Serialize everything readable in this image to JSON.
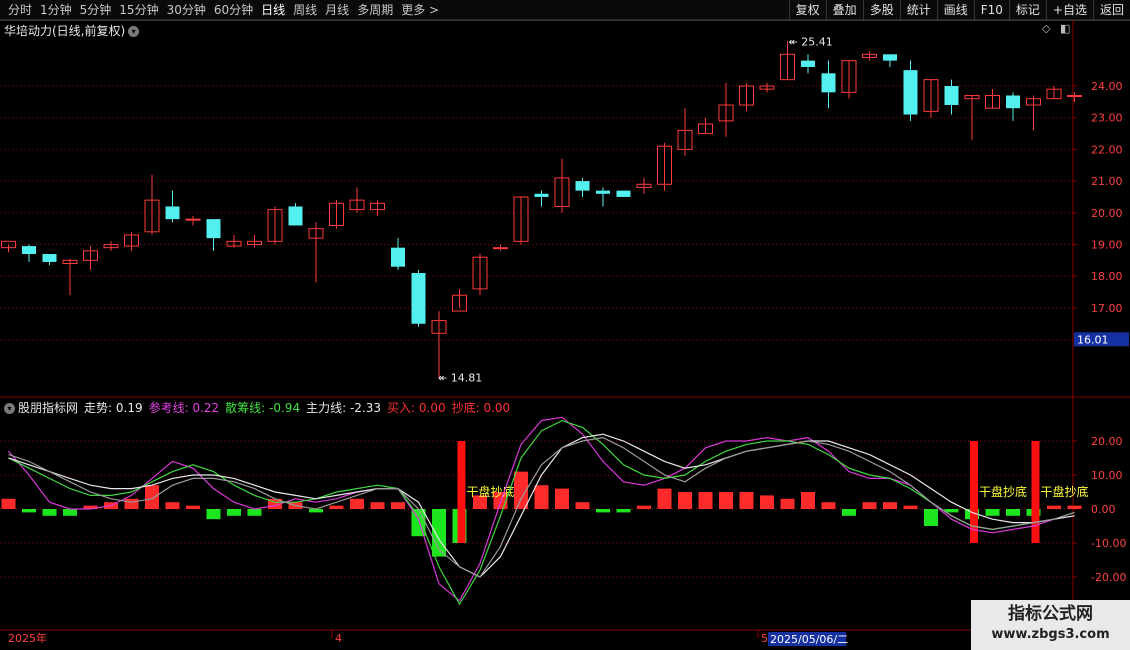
{
  "toolbar": {
    "periods": [
      "分时",
      "1分钟",
      "5分钟",
      "15分钟",
      "30分钟",
      "60分钟",
      "日线",
      "周线",
      "月线",
      "多周期",
      "更多 >"
    ],
    "active_period": "日线",
    "buttons": [
      "复权",
      "叠加",
      "多股",
      "统计",
      "画线",
      "F10",
      "标记",
      "+自选",
      "返回"
    ]
  },
  "stock": {
    "title": "华培动力(日线,前复权)",
    "high_label": "25.41",
    "low_label": "14.81",
    "current_price": "16.01",
    "price_ticks": [
      "24.00",
      "23.00",
      "22.00",
      "21.00",
      "20.00",
      "19.00",
      "18.00",
      "17.00",
      "16.00"
    ]
  },
  "indicator": {
    "name": "股朋指标网",
    "values": [
      {
        "label": "走势: 0.19",
        "color": "#e8e8e8"
      },
      {
        "label": "参考线: 0.22",
        "color": "#e040e0"
      },
      {
        "label": "散筹线: -0.94",
        "color": "#40e040"
      },
      {
        "label": "主力线: -2.33",
        "color": "#e8e8e8"
      },
      {
        "label": "买入: 0.00",
        "color": "#ff3030"
      },
      {
        "label": "抄底: 0.00",
        "color": "#ff3030"
      }
    ],
    "ticks": [
      "20.00",
      "10.00",
      "0.00",
      "-10.00",
      "-20.00"
    ],
    "signal_label": "干盘抄底"
  },
  "timeline": {
    "labels": [
      "2025年",
      "4",
      "5"
    ],
    "cursor_date": "2025/05/06/二"
  },
  "watermark": {
    "title": "指标公式网",
    "url": "www.zbgs3.com"
  },
  "colors": {
    "up": "#ff3b3b",
    "down": "#54f0f0",
    "grid": "#8b0000",
    "axis_text": "#ff4040",
    "accent_blue": "#1530a0"
  },
  "chart_data": {
    "type": "candlestick",
    "candles": [
      [
        18.9,
        19.1,
        18.75,
        19.0
      ],
      [
        18.95,
        18.7,
        18.45,
        19.0
      ],
      [
        18.7,
        18.45,
        18.35,
        18.7
      ],
      [
        18.4,
        18.5,
        17.4,
        18.55
      ],
      [
        18.5,
        18.8,
        18.2,
        18.95
      ],
      [
        18.9,
        19.0,
        18.8,
        19.1
      ],
      [
        18.95,
        19.3,
        18.8,
        19.4
      ],
      [
        19.4,
        20.4,
        19.3,
        21.2
      ],
      [
        20.2,
        19.8,
        19.7,
        20.7
      ],
      [
        19.8,
        19.8,
        19.6,
        19.9
      ],
      [
        19.8,
        19.2,
        18.8,
        19.8
      ],
      [
        18.95,
        19.1,
        18.9,
        19.3
      ],
      [
        19.0,
        19.1,
        18.9,
        19.3
      ],
      [
        19.1,
        20.1,
        19.0,
        20.2
      ],
      [
        20.2,
        19.6,
        19.6,
        20.3
      ],
      [
        19.2,
        19.5,
        17.8,
        19.7
      ],
      [
        19.6,
        20.3,
        19.5,
        20.4
      ],
      [
        20.1,
        20.4,
        20.0,
        20.8
      ],
      [
        20.1,
        20.3,
        19.9,
        20.4
      ],
      [
        18.9,
        18.3,
        18.2,
        19.2
      ],
      [
        18.1,
        16.5,
        16.4,
        18.2
      ],
      [
        16.2,
        16.6,
        14.81,
        16.9
      ],
      [
        16.9,
        17.4,
        17.0,
        17.6
      ],
      [
        17.6,
        18.6,
        17.4,
        18.7
      ],
      [
        18.9,
        18.9,
        18.8,
        19.0
      ],
      [
        19.1,
        20.5,
        19.0,
        20.5
      ],
      [
        20.6,
        20.5,
        20.2,
        20.7
      ],
      [
        20.2,
        21.1,
        20.0,
        21.7
      ],
      [
        21.0,
        20.7,
        20.5,
        21.1
      ],
      [
        20.7,
        20.6,
        20.2,
        20.8
      ],
      [
        20.7,
        20.5,
        20.5,
        20.7
      ],
      [
        20.8,
        20.9,
        20.6,
        21.1
      ],
      [
        20.9,
        22.1,
        20.7,
        22.2
      ],
      [
        22.0,
        22.6,
        21.8,
        23.3
      ],
      [
        22.5,
        22.8,
        22.5,
        23.0
      ],
      [
        22.9,
        23.4,
        22.4,
        24.1
      ],
      [
        23.4,
        24.0,
        23.2,
        24.1
      ],
      [
        23.9,
        24.0,
        23.8,
        24.1
      ],
      [
        24.2,
        25.0,
        24.2,
        25.41
      ],
      [
        24.8,
        24.6,
        24.4,
        25.0
      ],
      [
        24.4,
        23.8,
        23.3,
        24.8
      ],
      [
        23.8,
        24.8,
        23.6,
        24.8
      ],
      [
        24.9,
        25.0,
        24.8,
        25.1
      ],
      [
        25.0,
        24.8,
        24.6,
        25.0
      ],
      [
        24.5,
        23.1,
        22.9,
        24.8
      ],
      [
        23.2,
        24.2,
        23.0,
        24.2
      ],
      [
        24.0,
        23.4,
        23.1,
        24.2
      ],
      [
        23.6,
        23.7,
        22.3,
        23.7
      ],
      [
        23.3,
        23.7,
        23.3,
        23.9
      ],
      [
        23.7,
        23.3,
        22.9,
        23.8
      ],
      [
        23.4,
        23.6,
        22.6,
        23.7
      ],
      [
        23.6,
        23.9,
        23.6,
        24.0
      ],
      [
        23.7,
        23.7,
        23.5,
        23.8
      ]
    ],
    "histogram": [
      3,
      -1,
      -2,
      -2,
      1,
      2,
      3,
      7,
      2,
      1,
      -3,
      -2,
      -2,
      3,
      2,
      -1,
      1,
      3,
      2,
      2,
      -8,
      -14,
      -10,
      4,
      5,
      11,
      7,
      6,
      2,
      -1,
      -1,
      1,
      6,
      5,
      5,
      5,
      5,
      4,
      3,
      5,
      2,
      -2,
      2,
      2,
      1,
      -5,
      -1,
      -3,
      -2,
      -2,
      -2,
      1,
      1
    ],
    "buy_signals": [
      22,
      47,
      50
    ],
    "lines": {
      "zoushi": [
        16,
        14,
        11,
        8,
        5,
        3,
        2,
        3,
        7,
        9,
        9,
        8,
        6,
        3,
        1,
        0,
        2,
        4,
        6,
        6,
        0,
        -12,
        -17,
        -20,
        -11,
        3,
        13,
        18,
        20,
        21,
        18,
        14,
        10,
        8,
        12,
        15,
        17,
        18,
        19,
        20,
        19,
        17,
        14,
        11,
        7,
        2,
        -2,
        -5,
        -6,
        -5,
        -4,
        -3,
        -1
      ],
      "cankao": [
        17,
        10,
        2,
        0,
        0,
        1,
        4,
        9,
        14,
        12,
        6,
        2,
        0,
        1,
        3,
        2,
        3,
        5,
        6,
        6,
        -3,
        -22,
        -27,
        -16,
        2,
        19,
        26,
        27,
        22,
        14,
        8,
        7,
        9,
        12,
        18,
        20,
        20,
        21,
        20,
        21,
        17,
        11,
        9,
        9,
        7,
        2,
        -3,
        -6,
        -7,
        -6,
        -5,
        -3,
        -2
      ],
      "sanchou": [
        15,
        12,
        9,
        6,
        4,
        4,
        5,
        8,
        11,
        13,
        11,
        7,
        4,
        2,
        2,
        3,
        5,
        6,
        7,
        6,
        -2,
        -17,
        -28,
        -18,
        -2,
        15,
        23,
        26,
        24,
        19,
        13,
        10,
        9,
        10,
        14,
        17,
        19,
        20,
        20,
        19,
        16,
        12,
        10,
        9,
        6,
        2,
        -2,
        -5,
        -6,
        -5,
        -4,
        -3,
        -1
      ],
      "zhuli": [
        15,
        13,
        11,
        9,
        7,
        6,
        6,
        7,
        9,
        10,
        10,
        9,
        7,
        5,
        4,
        3,
        4,
        5,
        6,
        6,
        2,
        -9,
        -17,
        -20,
        -14,
        -2,
        10,
        18,
        21,
        22,
        20,
        17,
        14,
        12,
        13,
        15,
        17,
        18,
        19,
        20,
        20,
        18,
        16,
        13,
        10,
        6,
        2,
        -1,
        -3,
        -4,
        -4,
        -3,
        -2
      ]
    }
  }
}
